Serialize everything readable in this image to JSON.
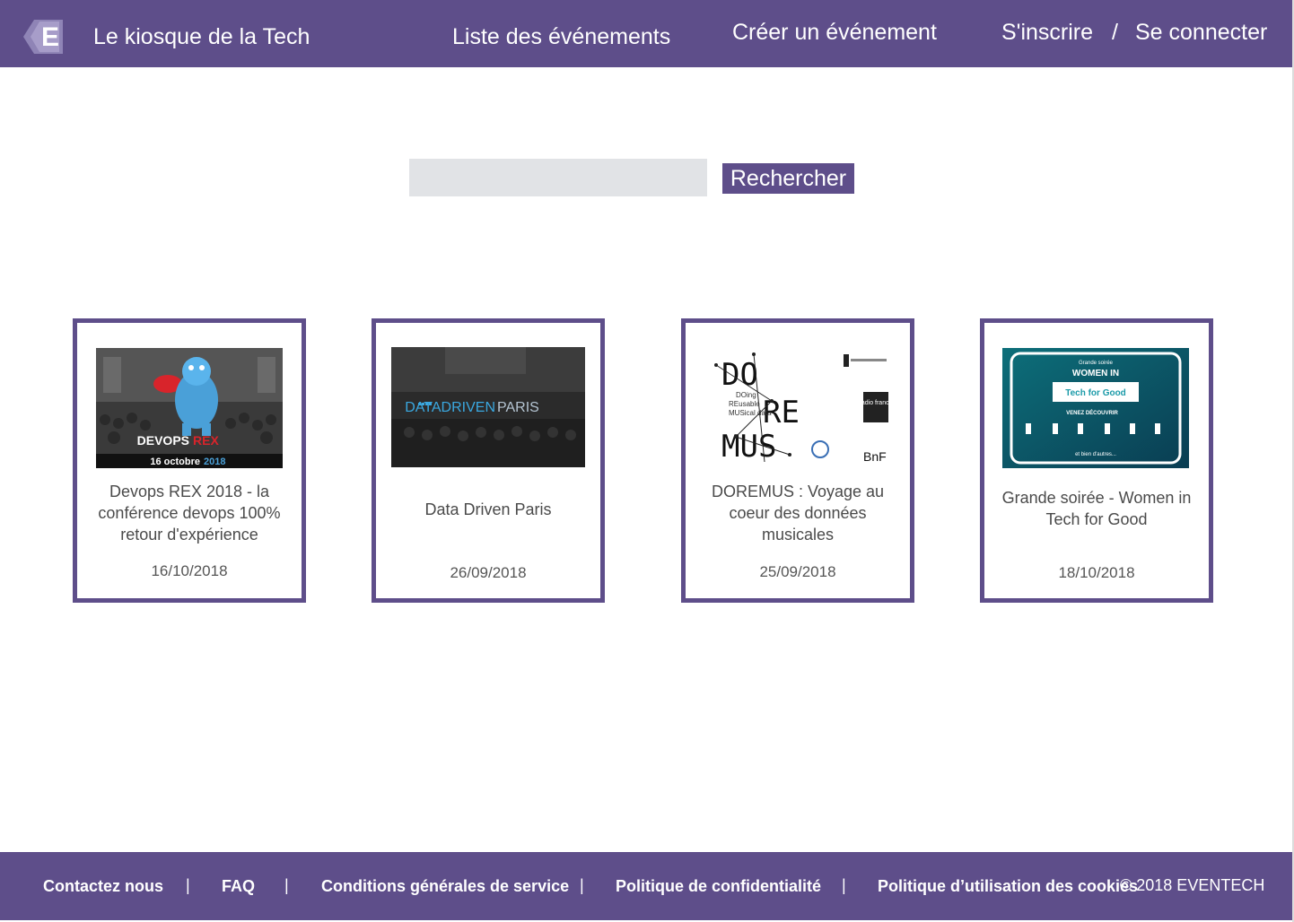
{
  "header": {
    "brand": "Le kiosque de la Tech",
    "nav": {
      "events": "Liste des événements",
      "create": "Créer un événement",
      "register": "S'inscrire",
      "separator": "/",
      "login": "Se connecter"
    }
  },
  "search": {
    "value": "",
    "button_label": "Rechercher"
  },
  "events": [
    {
      "title": "Devops REX 2018 - la conférence devops 100% retour d'expérience",
      "date": "16/10/2018",
      "image_text": {
        "brand_a": "DEVOPS",
        "brand_b": "REX",
        "date_a": "16 octobre",
        "date_b": "2018"
      }
    },
    {
      "title": "Data Driven Paris",
      "date": "26/09/2018",
      "image_text": {
        "brand_a": "DATADRIVEN",
        "brand_b": "PARIS"
      }
    },
    {
      "title": "DOREMUS : Voyage au coeur des données musicales",
      "date": "25/09/2018",
      "image_text": {
        "row1": "DO",
        "row2": "RE",
        "row3": "MUS",
        "bnf": "BnF",
        "radio": "radio france",
        "acr1": "DOing",
        "acr2": "REusable",
        "acr3": "MUSical data"
      }
    },
    {
      "title": "Grande soirée - Women in Tech for Good",
      "date": "18/10/2018",
      "image_text": {
        "top": "Grande soirée",
        "women": "WOMEN IN",
        "tag": "Tech for Good",
        "sub": "VENEZ DÉCOUVRIR",
        "bottom": "et bien d'autres..."
      }
    }
  ],
  "footer": {
    "links": {
      "contact": "Contactez nous",
      "faq": "FAQ",
      "terms": "Conditions générales de service",
      "privacy": "Politique de confidentialité",
      "cookies": "Politique d’utilisation des cookies"
    },
    "separator": "|",
    "copyright": "© 2018 EVENTECH"
  },
  "colors": {
    "brand": "#5e4e8a",
    "search_bg": "#e1e3e6",
    "white": "#ffffff"
  }
}
